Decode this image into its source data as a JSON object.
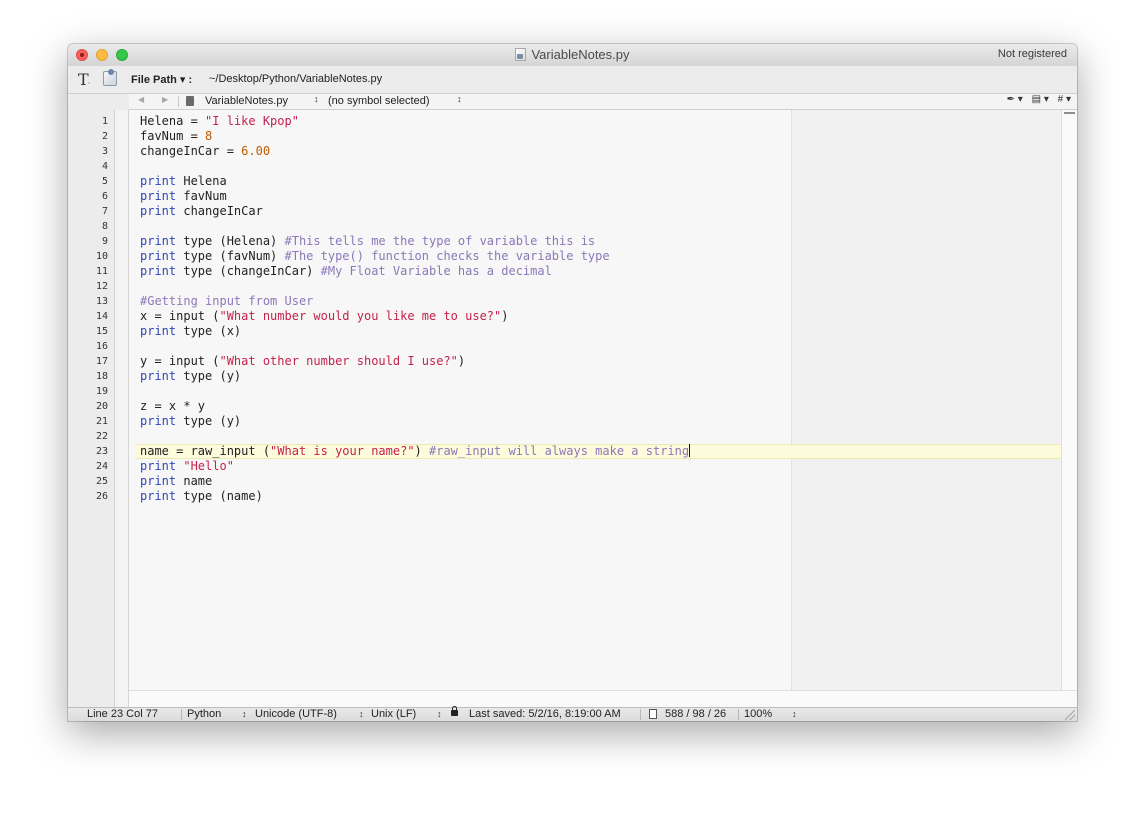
{
  "window": {
    "title": "VariableNotes.py",
    "registration": "Not registered"
  },
  "pathbar": {
    "label": "File Path ▾ :",
    "value": "~/Desktop/Python/VariableNotes.py"
  },
  "navbar": {
    "back": "◀",
    "forward": "▶",
    "file": "VariableNotes.py",
    "symbol": "(no symbol selected)",
    "popup_arrow": "↕",
    "tools": [
      "✒ ▾",
      "▤ ▾",
      "# ▾"
    ]
  },
  "editor": {
    "line_numbers": [
      "1",
      "2",
      "3",
      "4",
      "5",
      "6",
      "7",
      "8",
      "9",
      "10",
      "11",
      "12",
      "13",
      "14",
      "15",
      "16",
      "17",
      "18",
      "19",
      "20",
      "21",
      "22",
      "23",
      "24",
      "25",
      "26"
    ],
    "lines": [
      [
        {
          "t": "Helena = ",
          "c": ""
        },
        {
          "t": "\"I like Kpop\"",
          "c": "str"
        }
      ],
      [
        {
          "t": "favNum = ",
          "c": ""
        },
        {
          "t": "8",
          "c": "num"
        }
      ],
      [
        {
          "t": "changeInCar = ",
          "c": ""
        },
        {
          "t": "6.00",
          "c": "num"
        }
      ],
      [],
      [
        {
          "t": "print",
          "c": "kw"
        },
        {
          "t": " Helena",
          "c": ""
        }
      ],
      [
        {
          "t": "print",
          "c": "kw"
        },
        {
          "t": " favNum",
          "c": ""
        }
      ],
      [
        {
          "t": "print",
          "c": "kw"
        },
        {
          "t": " changeInCar",
          "c": ""
        }
      ],
      [],
      [
        {
          "t": "print",
          "c": "kw"
        },
        {
          "t": " type (Helena) ",
          "c": ""
        },
        {
          "t": "#This tells me the type of variable this is",
          "c": "cmt"
        }
      ],
      [
        {
          "t": "print",
          "c": "kw"
        },
        {
          "t": " type (favNum) ",
          "c": ""
        },
        {
          "t": "#The type() function checks the variable type",
          "c": "cmt"
        }
      ],
      [
        {
          "t": "print",
          "c": "kw"
        },
        {
          "t": " type (changeInCar) ",
          "c": ""
        },
        {
          "t": "#My Float Variable has a decimal",
          "c": "cmt"
        }
      ],
      [],
      [
        {
          "t": "#Getting input from User",
          "c": "cmt"
        }
      ],
      [
        {
          "t": "x = input (",
          "c": ""
        },
        {
          "t": "\"What number would you like me to use?\"",
          "c": "str"
        },
        {
          "t": ")",
          "c": ""
        }
      ],
      [
        {
          "t": "print",
          "c": "kw"
        },
        {
          "t": " type (x)",
          "c": ""
        }
      ],
      [],
      [
        {
          "t": "y = input (",
          "c": ""
        },
        {
          "t": "\"What other number should I use?\"",
          "c": "str"
        },
        {
          "t": ")",
          "c": ""
        }
      ],
      [
        {
          "t": "print",
          "c": "kw"
        },
        {
          "t": " type (y)",
          "c": ""
        }
      ],
      [],
      [
        {
          "t": "z = x * y",
          "c": ""
        }
      ],
      [
        {
          "t": "print",
          "c": "kw"
        },
        {
          "t": " type (y)",
          "c": ""
        }
      ],
      [],
      [
        {
          "t": "name = raw_input (",
          "c": ""
        },
        {
          "t": "\"What is your name?\"",
          "c": "str"
        },
        {
          "t": ") ",
          "c": ""
        },
        {
          "t": "#raw_input will always make a string",
          "c": "cmt"
        }
      ],
      [
        {
          "t": "print",
          "c": "kw"
        },
        {
          "t": " ",
          "c": ""
        },
        {
          "t": "\"Hello\"",
          "c": "str"
        }
      ],
      [
        {
          "t": "print",
          "c": "kw"
        },
        {
          "t": " name",
          "c": ""
        }
      ],
      [
        {
          "t": "print",
          "c": "kw"
        },
        {
          "t": " type (name)",
          "c": ""
        }
      ]
    ],
    "current_line": 23
  },
  "statusbar": {
    "position": "Line 23 Col 77",
    "language": "Python",
    "encoding": "Unicode (UTF-8)",
    "line_endings": "Unix (LF)",
    "last_saved": "Last saved: 5/2/16, 8:19:00 AM",
    "counts": "588 / 98 / 26",
    "zoom": "100%",
    "popup_arrow": "↕"
  },
  "colors": {
    "keyword": "#2f47b8",
    "string": "#c4224d",
    "number": "#c05a00",
    "comment": "#8c78b8",
    "current_line": "#fdfbdc"
  }
}
